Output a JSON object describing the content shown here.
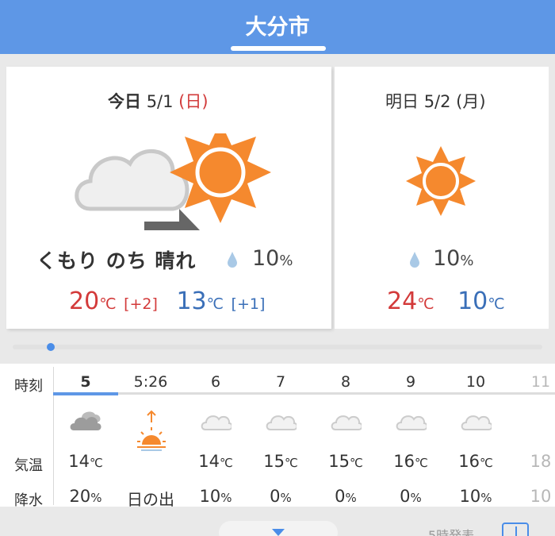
{
  "header": {
    "title": "大分市"
  },
  "today": {
    "label": "今日",
    "date": "5/1",
    "dow": "(日)",
    "weather": "くもり のち 晴れ",
    "rain_value": "10",
    "rain_unit": "%",
    "high": "20",
    "high_diff": "[+2]",
    "low": "13",
    "low_diff": "[+1]",
    "temp_unit": "℃"
  },
  "tomorrow": {
    "label": "明日",
    "date": "5/2",
    "dow": "(月)",
    "rain_value": "10",
    "rain_unit": "%",
    "high": "24",
    "low": "10",
    "temp_unit": "℃"
  },
  "hourly": {
    "labels": {
      "time": "時刻",
      "temp": "気温",
      "precip": "降水"
    },
    "columns": [
      {
        "time": "5",
        "icon": "cloudy-icon",
        "temp": "14",
        "precip": "20",
        "unit_t": "℃",
        "unit_p": "%"
      },
      {
        "time": "5:26",
        "icon": "sunrise-icon",
        "temp": "",
        "precip": "日の出",
        "unit_t": "",
        "unit_p": ""
      },
      {
        "time": "6",
        "icon": "cloud-icon",
        "temp": "14",
        "precip": "10",
        "unit_t": "℃",
        "unit_p": "%"
      },
      {
        "time": "7",
        "icon": "cloud-icon",
        "temp": "15",
        "precip": "0",
        "unit_t": "℃",
        "unit_p": "%"
      },
      {
        "time": "8",
        "icon": "cloud-icon",
        "temp": "15",
        "precip": "0",
        "unit_t": "℃",
        "unit_p": "%"
      },
      {
        "time": "9",
        "icon": "cloud-icon",
        "temp": "16",
        "precip": "0",
        "unit_t": "℃",
        "unit_p": "%"
      },
      {
        "time": "10",
        "icon": "cloud-icon",
        "temp": "16",
        "precip": "10",
        "unit_t": "℃",
        "unit_p": "%"
      },
      {
        "time": "11",
        "icon": "cloud-icon",
        "temp": "18",
        "precip": "10",
        "unit_t": "",
        "unit_p": ""
      }
    ]
  },
  "footer": {
    "announce": "5時発表"
  },
  "colors": {
    "header": "#5e97e6",
    "high": "#d33a3a",
    "low": "#3a6fb8",
    "sun": "#f5892e"
  }
}
